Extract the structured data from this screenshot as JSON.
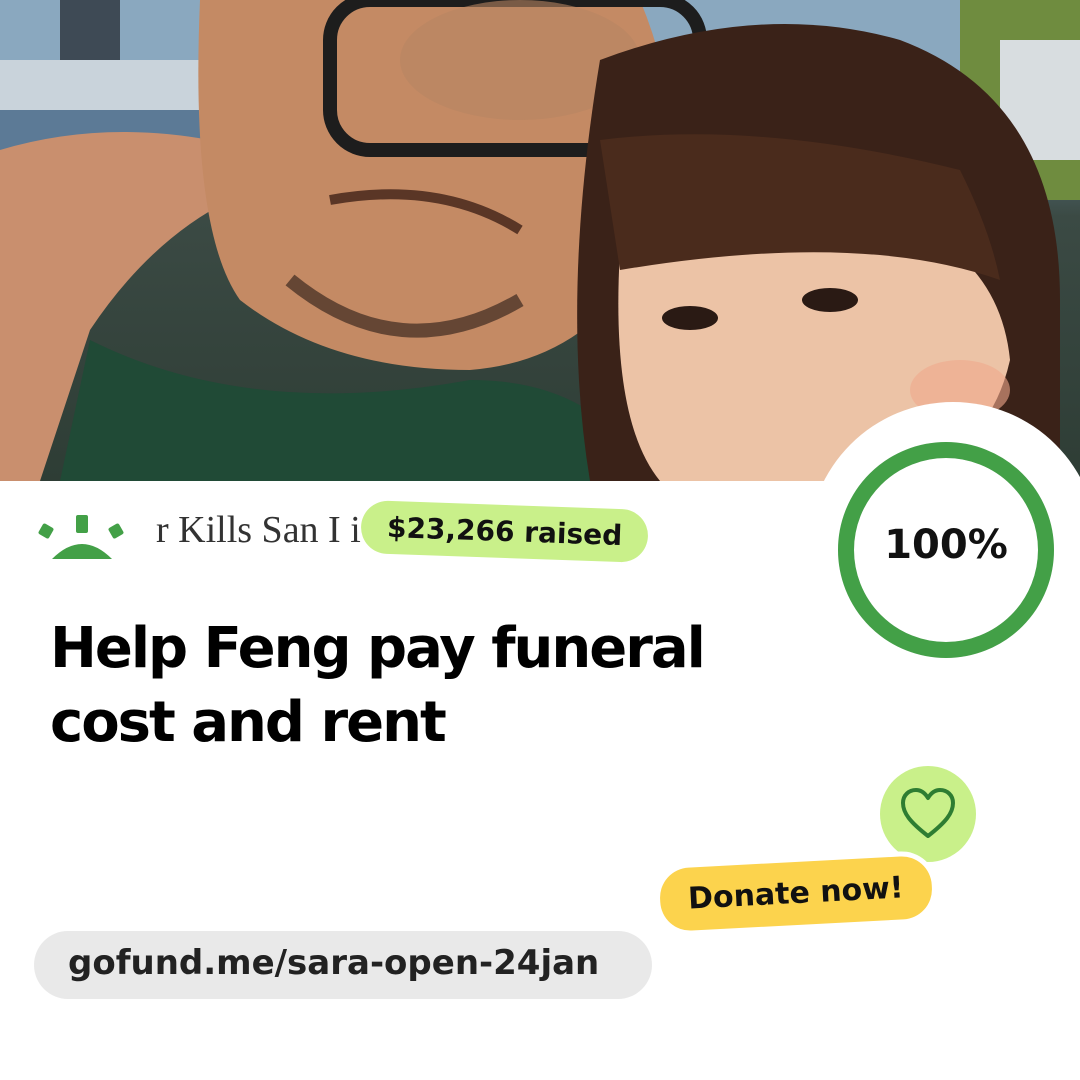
{
  "colors": {
    "brand_green": "#43a047",
    "raised_pill": "#c9f08a",
    "donate_pill": "#fcd34d",
    "url_pill": "#e9e9e9",
    "title_text": "#000000"
  },
  "photo": {
    "icon": "campaign-photo"
  },
  "headline_snippet": "r Kills San I                                  ing To",
  "raised": {
    "label": "$23,266 raised"
  },
  "progress": {
    "percent_label": "100%",
    "percent": 100
  },
  "title": {
    "line1": "Help Feng pay funeral",
    "line2": "cost and rent"
  },
  "donate": {
    "label": "Donate now!",
    "icon": "heart-icon"
  },
  "url": {
    "label": "gofund.me/sara-open-24jan"
  },
  "logo": {
    "icon": "gofundme-sun-icon"
  }
}
